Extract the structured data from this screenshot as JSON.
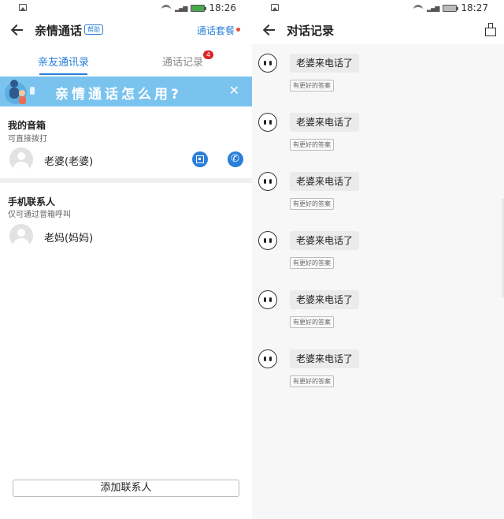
{
  "left_screen": {
    "status_bar": {
      "time": "18:26"
    },
    "header": {
      "title": "亲情通话",
      "help_badge": "帮助",
      "plan_link": "通话套餐"
    },
    "tabs": [
      {
        "label": "亲友通讯录",
        "active": true
      },
      {
        "label": "通话记录",
        "active": false,
        "badge": "4"
      }
    ],
    "banner": {
      "text": "亲情通话怎么用?"
    },
    "my_speaker": {
      "title": "我的音箱",
      "subtitle": "可直接拨打",
      "contacts": [
        {
          "name": "老婆(老婆)",
          "actions": [
            "qr-code-icon",
            "phone-icon"
          ]
        }
      ]
    },
    "phone_contacts": {
      "title": "手机联系人",
      "subtitle": "仅可通过音箱呼叫",
      "contacts": [
        {
          "name": "老妈(妈妈)"
        }
      ]
    },
    "add_button": "添加联系人"
  },
  "right_screen": {
    "status_bar": {
      "time": "18:27"
    },
    "header": {
      "title": "对话记录"
    },
    "messages": [
      {
        "text": "老婆来电话了",
        "action": "有更好的答案"
      },
      {
        "text": "老婆来电话了",
        "action": "有更好的答案"
      },
      {
        "text": "老婆来电话了",
        "action": "有更好的答案"
      },
      {
        "text": "老婆来电话了",
        "action": "有更好的答案"
      },
      {
        "text": "老婆来电话了",
        "action": "有更好的答案"
      },
      {
        "text": "老婆来电话了",
        "action": "有更好的答案"
      }
    ]
  },
  "colors": {
    "accent": "#2a7fd8",
    "banner": "#7ac3ee",
    "badge": "#d9252a",
    "dot": "#e2502f"
  }
}
